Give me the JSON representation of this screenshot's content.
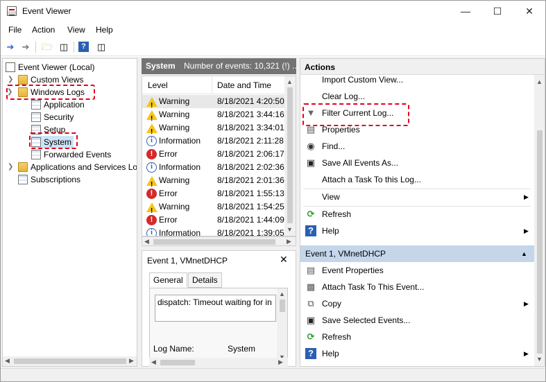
{
  "window": {
    "title": "Event Viewer"
  },
  "menu": [
    "File",
    "Action",
    "View",
    "Help"
  ],
  "tree": {
    "root": "Event Viewer (Local)",
    "custom_views": "Custom Views",
    "windows_logs": "Windows Logs",
    "logs": [
      "Application",
      "Security",
      "Setup",
      "System",
      "Forwarded Events"
    ],
    "apps_services": "Applications and Services Lo",
    "subscriptions": "Subscriptions"
  },
  "log_header": {
    "name": "System",
    "count": "Number of events: 10,321 (!) ..."
  },
  "events": {
    "columns": [
      "Level",
      "Date and Time"
    ],
    "rows": [
      {
        "level": "Warning",
        "icon": "warning-icon",
        "time": "8/18/2021 4:20:50"
      },
      {
        "level": "Warning",
        "icon": "warning-icon",
        "time": "8/18/2021 3:44:16"
      },
      {
        "level": "Warning",
        "icon": "warning-icon",
        "time": "8/18/2021 3:34:01"
      },
      {
        "level": "Information",
        "icon": "info-icon",
        "time": "8/18/2021 2:11:28"
      },
      {
        "level": "Error",
        "icon": "error-icon",
        "time": "8/18/2021 2:06:17"
      },
      {
        "level": "Information",
        "icon": "info-icon",
        "time": "8/18/2021 2:02:36"
      },
      {
        "level": "Warning",
        "icon": "warning-icon",
        "time": "8/18/2021 2:01:36"
      },
      {
        "level": "Error",
        "icon": "error-icon",
        "time": "8/18/2021 1:55:13"
      },
      {
        "level": "Warning",
        "icon": "warning-icon",
        "time": "8/18/2021 1:54:25"
      },
      {
        "level": "Error",
        "icon": "error-icon",
        "time": "8/18/2021 1:44:09"
      },
      {
        "level": "Information",
        "icon": "info-icon",
        "time": "8/18/2021 1:39:05"
      }
    ]
  },
  "detail": {
    "title": "Event 1, VMnetDHCP",
    "tabs": [
      "General",
      "Details"
    ],
    "description": "dispatch: Timeout waiting for in",
    "log_name_label": "Log Name:",
    "log_name_value": "System"
  },
  "actions": {
    "header": "Actions",
    "log_actions": [
      {
        "label": "Import Custom View...",
        "icon": ""
      },
      {
        "label": "Clear Log...",
        "icon": ""
      },
      {
        "label": "Filter Current Log...",
        "icon": "filter-icon"
      },
      {
        "label": "Properties",
        "icon": "properties-icon"
      },
      {
        "label": "Find...",
        "icon": "binoculars-icon"
      },
      {
        "label": "Save All Events As...",
        "icon": "save-icon"
      },
      {
        "label": "Attach a Task To this Log...",
        "icon": ""
      },
      {
        "label": "View",
        "icon": ""
      },
      {
        "label": "Refresh",
        "icon": "refresh-icon"
      },
      {
        "label": "Help",
        "icon": "help-icon"
      }
    ],
    "event_section": "Event 1, VMnetDHCP",
    "event_actions": [
      {
        "label": "Event Properties",
        "icon": "event-properties-icon"
      },
      {
        "label": "Attach Task To This Event...",
        "icon": "attach-task-icon"
      },
      {
        "label": "Copy",
        "icon": "copy-icon"
      },
      {
        "label": "Save Selected Events...",
        "icon": "save-icon"
      },
      {
        "label": "Refresh",
        "icon": "refresh-icon"
      },
      {
        "label": "Help",
        "icon": "help-icon"
      }
    ]
  },
  "colors": {
    "highlight": "#e3001b",
    "section": "#c5d6ea",
    "header": "#737373"
  }
}
